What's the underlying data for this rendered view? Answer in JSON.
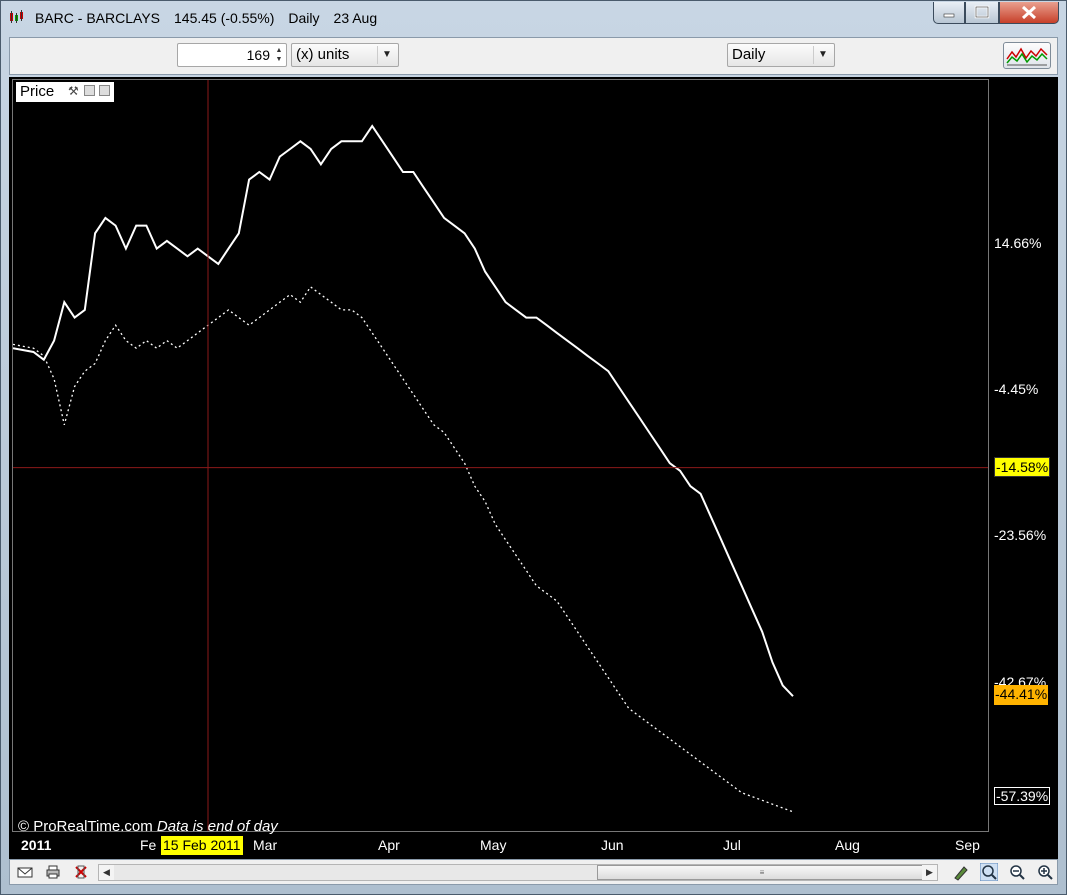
{
  "window": {
    "symbol": "BARC - BARCLAYS",
    "quote": "145.45 (-0.55%)",
    "period": "Daily",
    "date": "23 Aug",
    "icons": [
      "minimize-icon",
      "maximize-icon",
      "close-icon"
    ]
  },
  "toolbar": {
    "units_value": "169",
    "units_type": "(x) units",
    "timeframe": "Daily",
    "indicators_icon": "indicators-icon"
  },
  "panel": {
    "label": "Price",
    "icons": [
      "wrench-icon",
      "expand-icon",
      "collapse-icon"
    ]
  },
  "footer": {
    "copyright": "© ProRealTime.com",
    "note": "Data is end of day"
  },
  "bottom_icons": [
    "mail-icon",
    "print-icon",
    "delete-icon",
    "scroll-left-icon",
    "scroll-right-icon",
    "draw-icon",
    "zoom-fit-icon",
    "zoom-out-icon",
    "zoom-in-icon"
  ],
  "colors": {
    "background": "#000000",
    "line": "#ffffff",
    "crosshair": "#8b1a1a",
    "highlight": "#ffff00",
    "tag_orange": "#ffb300"
  },
  "chart_data": {
    "type": "line",
    "x_axis": {
      "labels": [
        "2011",
        "Fe",
        "Mar",
        "Apr",
        "May",
        "Jun",
        "Jul",
        "Aug",
        "Sep"
      ]
    },
    "y_axis": {
      "unit": "%",
      "tick_labels": [
        "14.66%",
        "-4.45%",
        "-23.56%",
        "-42.67%",
        "-57.39%"
      ],
      "ticks": [
        14.66,
        -4.45,
        -23.56,
        -42.67,
        -57.39
      ],
      "range": [
        -62,
        36
      ]
    },
    "crosshair": {
      "date_label": "15 Feb 2011",
      "value_label": "-14.58%",
      "value": -14.58
    },
    "last_value_tag": {
      "label": "-44.41%",
      "value": -44.41
    },
    "series": [
      {
        "style": "solid",
        "points": [
          [
            0,
            1
          ],
          [
            4,
            0.5
          ],
          [
            6,
            -0.5
          ],
          [
            8,
            2
          ],
          [
            10,
            7
          ],
          [
            12,
            5
          ],
          [
            14,
            6
          ],
          [
            16,
            16
          ],
          [
            18,
            18
          ],
          [
            20,
            17
          ],
          [
            22,
            14
          ],
          [
            24,
            17
          ],
          [
            26,
            17
          ],
          [
            28,
            14
          ],
          [
            30,
            15
          ],
          [
            32,
            14
          ],
          [
            34,
            13
          ],
          [
            36,
            14
          ],
          [
            38,
            13
          ],
          [
            40,
            12
          ],
          [
            42,
            14
          ],
          [
            44,
            16
          ],
          [
            46,
            23
          ],
          [
            48,
            24
          ],
          [
            50,
            23
          ],
          [
            52,
            26
          ],
          [
            54,
            27
          ],
          [
            56,
            28
          ],
          [
            58,
            27
          ],
          [
            60,
            25
          ],
          [
            62,
            27
          ],
          [
            64,
            28
          ],
          [
            66,
            28
          ],
          [
            68,
            28
          ],
          [
            70,
            30
          ],
          [
            72,
            28
          ],
          [
            74,
            26
          ],
          [
            76,
            24
          ],
          [
            78,
            24
          ],
          [
            80,
            22
          ],
          [
            82,
            20
          ],
          [
            84,
            18
          ],
          [
            86,
            17
          ],
          [
            88,
            16
          ],
          [
            90,
            14
          ],
          [
            92,
            11
          ],
          [
            94,
            9
          ],
          [
            96,
            7
          ],
          [
            98,
            6
          ],
          [
            100,
            5
          ],
          [
            102,
            5
          ],
          [
            104,
            4
          ],
          [
            106,
            3
          ],
          [
            108,
            2
          ],
          [
            110,
            1
          ],
          [
            112,
            0
          ],
          [
            114,
            -1
          ],
          [
            116,
            -2
          ],
          [
            118,
            -4
          ],
          [
            120,
            -6
          ],
          [
            122,
            -8
          ],
          [
            124,
            -10
          ],
          [
            126,
            -12
          ],
          [
            128,
            -14
          ],
          [
            130,
            -15
          ],
          [
            132,
            -17
          ],
          [
            134,
            -18
          ],
          [
            136,
            -21
          ],
          [
            138,
            -24
          ],
          [
            140,
            -27
          ],
          [
            142,
            -30
          ],
          [
            144,
            -33
          ],
          [
            146,
            -36
          ],
          [
            148,
            -40
          ],
          [
            150,
            -43
          ],
          [
            152,
            -44.41
          ]
        ]
      },
      {
        "style": "dotted",
        "points": [
          [
            0,
            1.5
          ],
          [
            4,
            1
          ],
          [
            6,
            0
          ],
          [
            8,
            -3
          ],
          [
            10,
            -9
          ],
          [
            12,
            -4
          ],
          [
            14,
            -2
          ],
          [
            16,
            -1
          ],
          [
            18,
            2
          ],
          [
            20,
            4
          ],
          [
            22,
            2
          ],
          [
            24,
            1
          ],
          [
            26,
            2
          ],
          [
            28,
            1
          ],
          [
            30,
            2
          ],
          [
            32,
            1
          ],
          [
            34,
            2
          ],
          [
            36,
            3
          ],
          [
            38,
            4
          ],
          [
            40,
            5
          ],
          [
            42,
            6
          ],
          [
            44,
            5
          ],
          [
            46,
            4
          ],
          [
            48,
            5
          ],
          [
            50,
            6
          ],
          [
            52,
            7
          ],
          [
            54,
            8
          ],
          [
            56,
            7
          ],
          [
            58,
            9
          ],
          [
            60,
            8
          ],
          [
            62,
            7
          ],
          [
            64,
            6
          ],
          [
            66,
            6
          ],
          [
            68,
            5
          ],
          [
            70,
            3
          ],
          [
            72,
            1
          ],
          [
            74,
            -1
          ],
          [
            76,
            -3
          ],
          [
            78,
            -5
          ],
          [
            80,
            -7
          ],
          [
            82,
            -9
          ],
          [
            84,
            -10
          ],
          [
            86,
            -12
          ],
          [
            88,
            -14
          ],
          [
            90,
            -17
          ],
          [
            92,
            -19
          ],
          [
            94,
            -22
          ],
          [
            96,
            -24
          ],
          [
            98,
            -26
          ],
          [
            100,
            -28
          ],
          [
            102,
            -30
          ],
          [
            104,
            -31
          ],
          [
            106,
            -32
          ],
          [
            108,
            -34
          ],
          [
            110,
            -36
          ],
          [
            112,
            -38
          ],
          [
            114,
            -40
          ],
          [
            116,
            -42
          ],
          [
            118,
            -44
          ],
          [
            120,
            -46
          ],
          [
            122,
            -47
          ],
          [
            124,
            -48
          ],
          [
            126,
            -49
          ],
          [
            128,
            -50
          ],
          [
            130,
            -51
          ],
          [
            132,
            -52
          ],
          [
            134,
            -53
          ],
          [
            136,
            -54
          ],
          [
            138,
            -55
          ],
          [
            140,
            -56
          ],
          [
            142,
            -57
          ],
          [
            144,
            -57.5
          ],
          [
            146,
            -58
          ],
          [
            148,
            -58.5
          ],
          [
            150,
            -59
          ],
          [
            152,
            -59.5
          ]
        ]
      }
    ]
  }
}
